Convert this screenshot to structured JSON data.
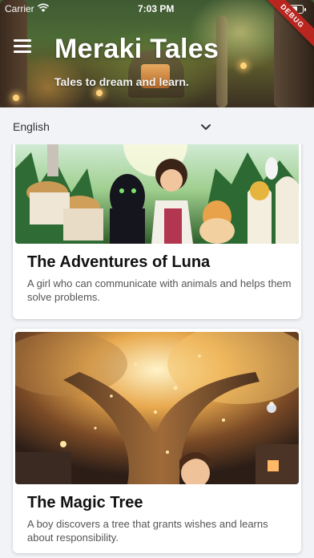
{
  "status_bar": {
    "carrier": "Carrier",
    "time": "7:03 PM",
    "battery_level": 0.8
  },
  "debug_banner": "DEBUG",
  "header": {
    "title": "Meraki Tales",
    "subtitle": "Tales to dream and learn.",
    "menu_icon": "hamburger-menu-icon"
  },
  "language": {
    "selected": "English",
    "icon": "chevron-down-icon"
  },
  "stories": [
    {
      "title": "The Adventures of Luna",
      "description": "A girl who can communicate with animals and helps them solve problems."
    },
    {
      "title": "The Magic Tree",
      "description": "A boy discovers a tree that grants wishes and learns about responsibility."
    }
  ],
  "colors": {
    "background": "#f1f3f7",
    "card": "#ffffff",
    "debug": "#b8261f",
    "title_text": "#111111"
  }
}
